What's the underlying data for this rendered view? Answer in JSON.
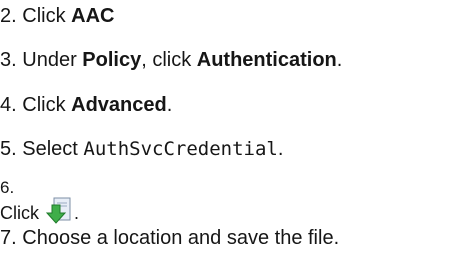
{
  "steps": [
    {
      "number": "2.",
      "prefix": "Click ",
      "bold": "AAC",
      "suffix": ""
    },
    {
      "number": "3.",
      "prefix": "Under ",
      "bold1": "Policy",
      "middle": ", click ",
      "bold2": "Authentication",
      "suffix": "."
    },
    {
      "number": "4.",
      "prefix": "Click ",
      "bold": "Advanced",
      "suffix": "."
    },
    {
      "number": "5.",
      "prefix": "Select ",
      "code": "AuthSvcCredential",
      "suffix": "."
    },
    {
      "number": "6.",
      "prefix": "Click",
      "icon": "download-icon",
      "suffix": "."
    },
    {
      "number": "7.",
      "text": "Choose a location and save the file."
    }
  ],
  "colors": {
    "text": "#161616",
    "icon_green": "#3fae49",
    "icon_page": "#e8eef7"
  }
}
